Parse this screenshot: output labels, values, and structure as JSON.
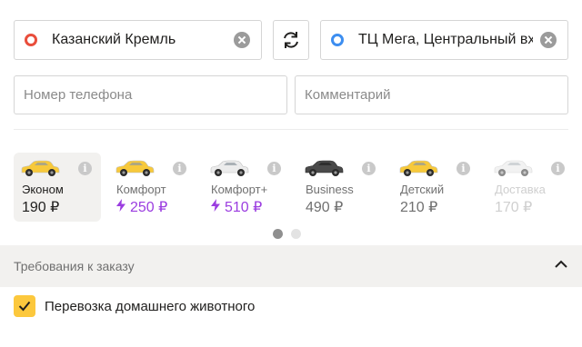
{
  "route": {
    "from": {
      "value": "Казанский Кремль",
      "dot_color": "#e94e3c"
    },
    "to": {
      "value": "ТЦ Мега, Центральный вхо",
      "dot_color": "#3d8ef0"
    },
    "swap_icon": "swap-arrows-icon",
    "clear_icon": "clear-icon"
  },
  "contact": {
    "phone_placeholder": "Номер телефона",
    "comment_placeholder": "Комментарий"
  },
  "tariffs": [
    {
      "name": "Эконом",
      "price": "190 ₽",
      "car_color": "#f7c93b",
      "selected": true,
      "surge": false,
      "available": true
    },
    {
      "name": "Комфорт",
      "price": "250 ₽",
      "car_color": "#f7c93b",
      "selected": false,
      "surge": true,
      "available": true
    },
    {
      "name": "Комфорт+",
      "price": "510 ₽",
      "car_color": "#ececec",
      "selected": false,
      "surge": true,
      "available": true
    },
    {
      "name": "Business",
      "price": "490 ₽",
      "car_color": "#4a4a4a",
      "selected": false,
      "surge": false,
      "available": true
    },
    {
      "name": "Детский",
      "price": "210 ₽",
      "car_color": "#f7c93b",
      "selected": false,
      "surge": false,
      "available": true
    },
    {
      "name": "Доставка",
      "price": "170 ₽",
      "car_color": "#e8e8e8",
      "selected": false,
      "surge": false,
      "available": false
    }
  ],
  "pagination": {
    "pages": 2,
    "current": 1
  },
  "requirements": {
    "title": "Требования к заказу",
    "expanded": true,
    "items": [
      {
        "label": "Перевозка домашнего животного",
        "checked": true
      }
    ]
  },
  "colors": {
    "accent": "#fcc83d",
    "surge": "#9b3de0"
  }
}
